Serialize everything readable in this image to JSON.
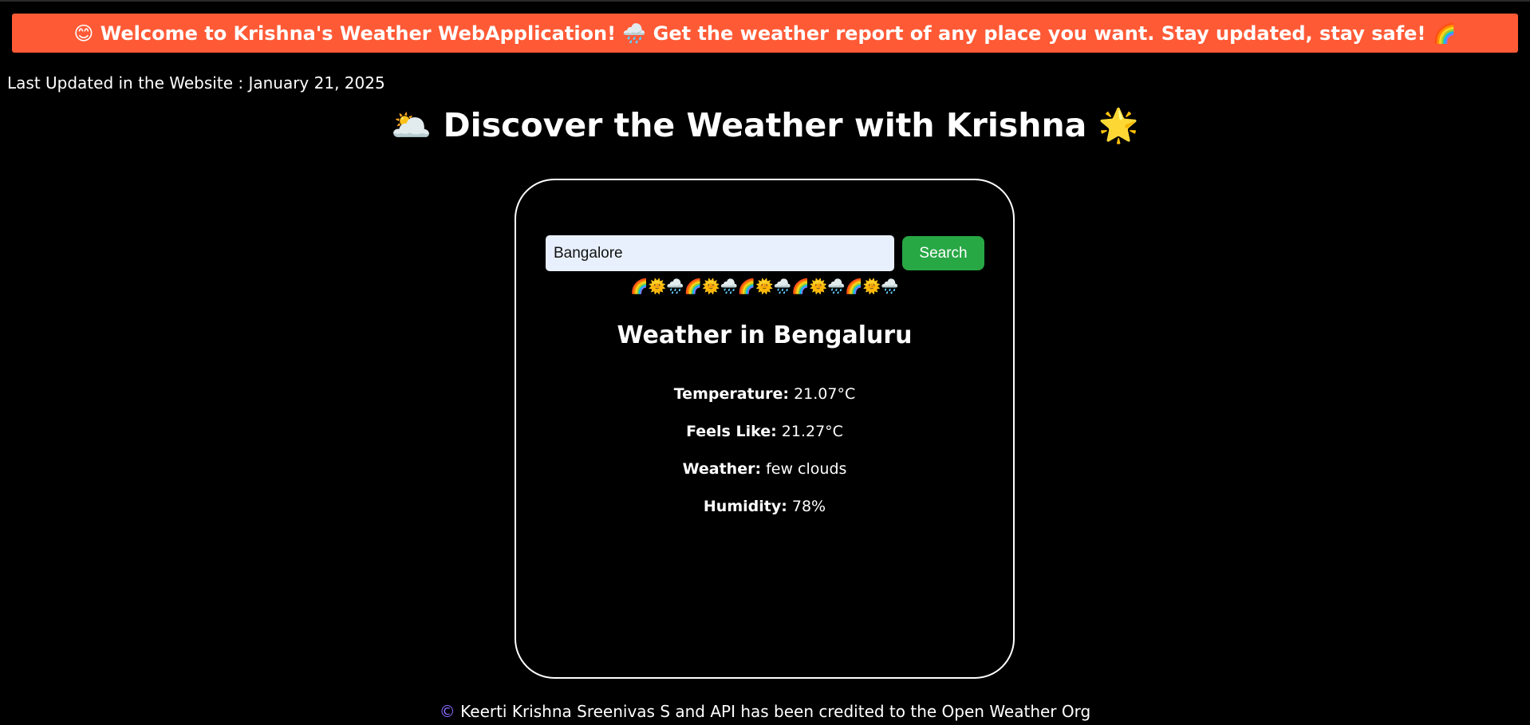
{
  "banner": {
    "text": "😊 Welcome to Krishna's Weather WebApplication! 🌧️ Get the weather report of any place you want. Stay updated, stay safe! 🌈"
  },
  "last_updated": "Last Updated in the Website : January 21, 2025",
  "page_title": "🌥️ Discover the Weather with Krishna 🌟",
  "search": {
    "value": "Bangalore",
    "placeholder": "",
    "button_label": "Search"
  },
  "emoji_strip": "🌈🌞🌧️🌈🌞🌧️🌈🌞🌧️🌈🌞🌧️🌈🌞🌧️",
  "weather": {
    "heading": "Weather in Bengaluru",
    "temperature_label": "Temperature:",
    "temperature_value": "21.07°C",
    "feels_like_label": "Feels Like:",
    "feels_like_value": "21.27°C",
    "condition_label": "Weather:",
    "condition_value": "few clouds",
    "humidity_label": "Humidity:",
    "humidity_value": "78%"
  },
  "footer": {
    "copyright_symbol": "©",
    "text": "Keerti Krishna Sreenivas S and API has been credited to the Open Weather Org"
  },
  "colors": {
    "background": "#000000",
    "banner": "#ff5a36",
    "search_button": "#28a745",
    "input_background": "#e8f0fe",
    "copyright": "#8a6bff"
  }
}
